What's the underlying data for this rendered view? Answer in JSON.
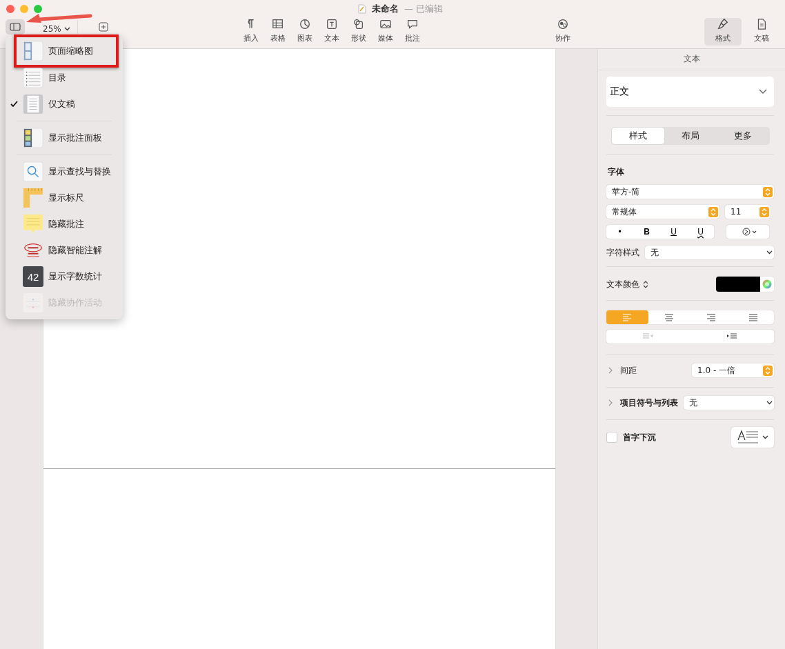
{
  "window": {
    "title": "未命名",
    "subtitle": "— 已编辑"
  },
  "toolbar": {
    "zoom": "25%",
    "items": [
      {
        "label": "插入",
        "kind": "pilcrow"
      },
      {
        "label": "表格",
        "kind": "table"
      },
      {
        "label": "图表",
        "kind": "chart"
      },
      {
        "label": "文本",
        "kind": "text"
      },
      {
        "label": "形状",
        "kind": "shape"
      },
      {
        "label": "媒体",
        "kind": "media"
      },
      {
        "label": "批注",
        "kind": "comment"
      }
    ],
    "collab": "协作",
    "right_tabs": [
      {
        "label": "格式",
        "kind": "brush",
        "selected": true
      },
      {
        "label": "文稿",
        "kind": "doc",
        "selected": false
      }
    ]
  },
  "menu": {
    "items": [
      {
        "label": "页面缩略图",
        "kind": "thumbs",
        "checked": false,
        "disabled": false,
        "annotated": true,
        "separator_after": false
      },
      {
        "label": "目录",
        "kind": "toc",
        "checked": false,
        "disabled": false,
        "annotated": false,
        "separator_after": false
      },
      {
        "label": "仅文稿",
        "kind": "doc",
        "checked": true,
        "disabled": false,
        "annotated": false,
        "separator_after": true
      },
      {
        "label": "显示批注面板",
        "kind": "panel",
        "checked": false,
        "disabled": false,
        "annotated": false,
        "separator_after": true
      },
      {
        "label": "显示查找与替换",
        "kind": "search",
        "checked": false,
        "disabled": false,
        "annotated": false,
        "separator_after": false
      },
      {
        "label": "显示标尺",
        "kind": "ruler",
        "checked": false,
        "disabled": false,
        "annotated": false,
        "separator_after": false
      },
      {
        "label": "隐藏批注",
        "kind": "note",
        "checked": false,
        "disabled": false,
        "annotated": false,
        "separator_after": false
      },
      {
        "label": "隐藏智能注解",
        "kind": "lorem",
        "checked": false,
        "disabled": false,
        "annotated": false,
        "separator_after": false
      },
      {
        "label": "显示字数统计",
        "kind": "count",
        "badge": "42",
        "checked": false,
        "disabled": false,
        "annotated": false,
        "separator_after": false
      },
      {
        "label": "隐藏协作活动",
        "kind": "activity",
        "checked": false,
        "disabled": true,
        "annotated": false,
        "separator_after": false
      }
    ]
  },
  "sidebar": {
    "title": "文本",
    "paragraph_style": "正文",
    "segments": [
      {
        "label": "样式",
        "selected": true
      },
      {
        "label": "布局",
        "selected": false
      },
      {
        "label": "更多",
        "selected": false
      }
    ],
    "font_heading": "字体",
    "font_family": "苹方-简",
    "font_weight": "常规体",
    "font_size": "11",
    "style_buttons": [
      {
        "label": "•",
        "kind": "plain"
      },
      {
        "label": "B",
        "kind": "bold"
      },
      {
        "label": "U",
        "kind": "underline"
      },
      {
        "label": "U",
        "kind": "double"
      }
    ],
    "char_style": {
      "label": "字符样式",
      "value": "无"
    },
    "text_color": {
      "label": "文本颜色",
      "color": "#000000"
    },
    "alignment": [
      {
        "kind": "left",
        "selected": true
      },
      {
        "kind": "center",
        "selected": false
      },
      {
        "kind": "right",
        "selected": false
      },
      {
        "kind": "justify",
        "selected": false
      }
    ],
    "spacing": {
      "label": "间距",
      "value": "1.0 - 一倍"
    },
    "bullets": {
      "label": "项目符号与列表",
      "value": "无"
    },
    "drop_cap": {
      "label": "首字下沉",
      "checked": false
    }
  }
}
